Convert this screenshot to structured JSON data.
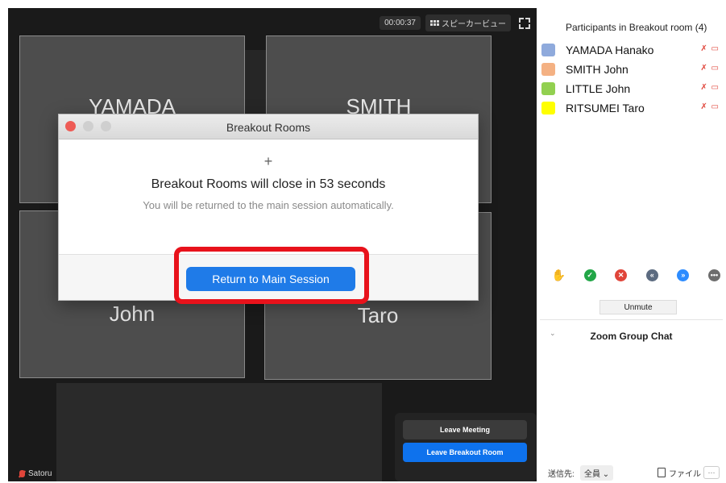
{
  "toolbar": {
    "timer": "00:00:37",
    "view_label": "スピーカービュー"
  },
  "tiles": {
    "yamada": "YAMADA",
    "smith": "SMITH",
    "little": "John",
    "ritsumei": "Taro"
  },
  "dialog": {
    "title": "Breakout Rooms",
    "plus": "+",
    "message": "Breakout Rooms will close in 53 seconds",
    "sub": "You will be returned to the main session automatically.",
    "return_label": "Return to Main Session"
  },
  "leave": {
    "meeting": "Leave Meeting",
    "breakout": "Leave Breakout Room"
  },
  "self_name": "Satoru",
  "participants": {
    "title": "Participants in Breakout room (4)",
    "items": [
      {
        "name": "YAMADA Hanako",
        "color": "#8faadc"
      },
      {
        "name": "SMITH John",
        "color": "#f4b183"
      },
      {
        "name": "LITTLE John",
        "color": "#92d050"
      },
      {
        "name": "RITSUMEI Taro",
        "color": "#ffff00"
      }
    ]
  },
  "controls": {
    "unmute": "Unmute"
  },
  "chat": {
    "title": "Zoom Group Chat",
    "send_to_label": "送信先:",
    "recipient": "全員 ⌄",
    "file_label": "ファイル",
    "more": "···"
  },
  "colors": {
    "highlight": "#e8121b",
    "accent": "#0e72ed"
  }
}
